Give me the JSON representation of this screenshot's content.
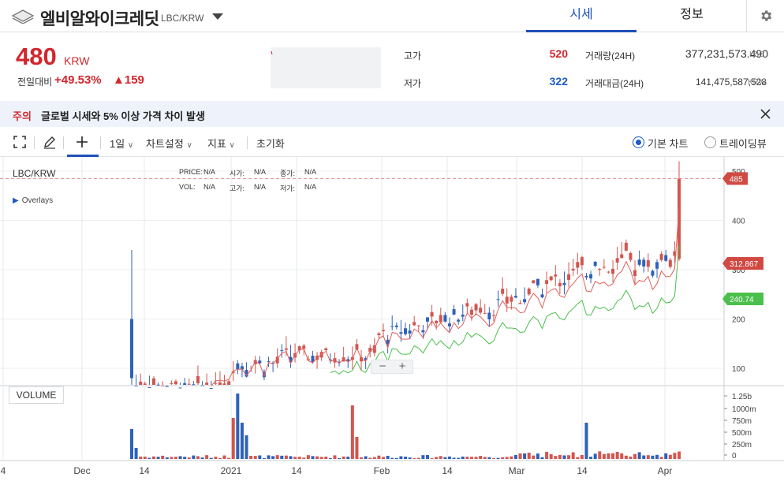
{
  "header": {
    "coin_name": "엘비알와이크레딧",
    "pair": "LBC/KRW",
    "tabs": [
      {
        "label": "시세",
        "active": true
      },
      {
        "label": "정보",
        "active": false
      }
    ]
  },
  "price": {
    "value": "480",
    "unit": "KRW",
    "change_label": "전일대비",
    "change_rate": "+49.53%",
    "change_amount": "▲159"
  },
  "stats": {
    "high_label": "고가",
    "high": "520",
    "low_label": "저가",
    "low": "322",
    "volume_label": "거래량(24H)",
    "volume": "377,231,573.490",
    "volume_unit": "LBC",
    "value_label": "거래대금(24H)",
    "value": "141,475,587,528",
    "value_unit": "KRW"
  },
  "notice": {
    "tag": "주의",
    "text": "글로벌 시세와 5% 이상 가격 차이 발생"
  },
  "toolbar": {
    "interval": "1일",
    "chart_settings": "차트설정",
    "indicators": "지표",
    "reset": "초기화",
    "radio_basic": "기본 차트",
    "radio_tv": "트레이딩뷰"
  },
  "chart_info": {
    "pair": "LBC/KRW",
    "price_label": "PRICE:",
    "price_val": "N/A",
    "open_label": "시가:",
    "open_val": "N/A",
    "close_label": "종가:",
    "close_val": "N/A",
    "vol_label": "VOL:",
    "vol_val": "N/A",
    "high_label": "고가:",
    "high_val": "N/A",
    "low_label": "저가:",
    "low_val": "N/A",
    "overlays": "Overlays",
    "volume_button": "VOLUME"
  },
  "colors": {
    "up": "#d2564f",
    "down": "#2e62b8",
    "ma_short": "#e0605a",
    "ma_long": "#4bbf4b",
    "accent": "#1e4fb8"
  },
  "chart_data": {
    "type": "candlestick",
    "y_axis_ticks": [
      "500",
      "400",
      "300",
      "200",
      "100"
    ],
    "volume_axis_ticks": [
      "1.25b",
      "1000m",
      "750m",
      "500m",
      "250m",
      "0"
    ],
    "x_axis_ticks": [
      "4",
      "Dec",
      "14",
      "2021",
      "14",
      "Feb",
      "14",
      "Mar",
      "14",
      "Apr"
    ],
    "price_tags": [
      {
        "label": "485",
        "value": 485
      },
      {
        "label": "312.867",
        "value": 312.867
      },
      {
        "label": "240.74",
        "value": 240.74
      }
    ]
  }
}
